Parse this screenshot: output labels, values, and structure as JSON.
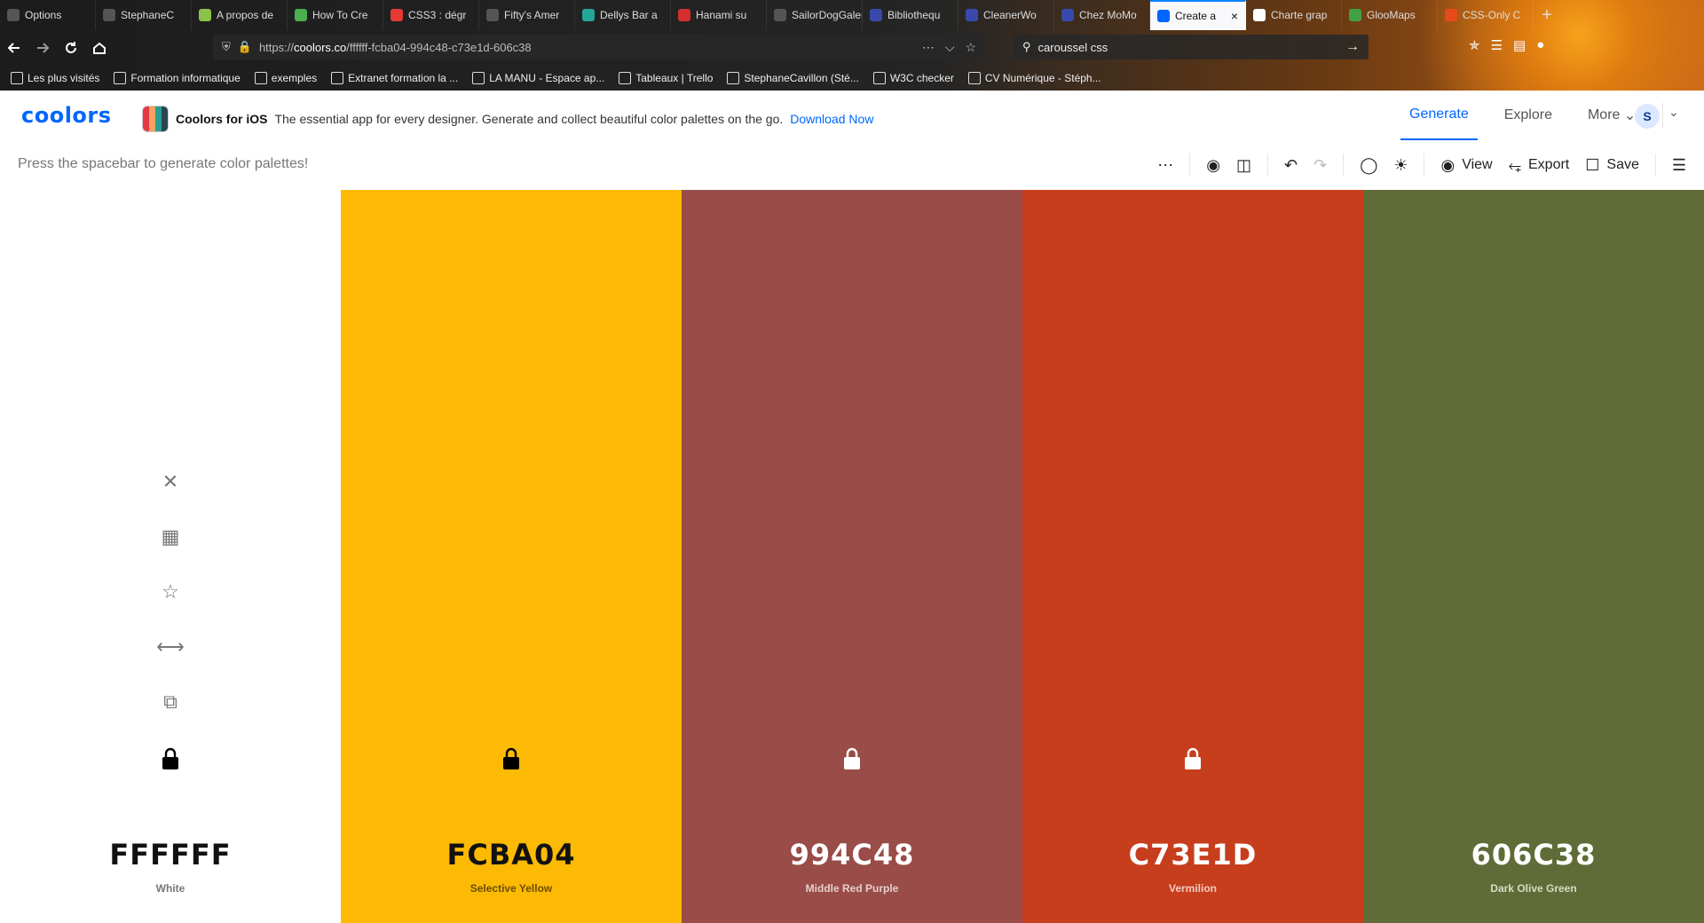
{
  "browser": {
    "tabs": [
      {
        "label": "Options",
        "color": "#555555",
        "active": false
      },
      {
        "label": "StephaneC",
        "color": "#555555",
        "active": false
      },
      {
        "label": "A propos de",
        "color": "#8bc34a",
        "active": false
      },
      {
        "label": "How To Cre",
        "color": "#4caf50",
        "active": false
      },
      {
        "label": "CSS3 : dégr",
        "color": "#e53935",
        "active": false
      },
      {
        "label": "Fifty's Amer",
        "color": "#555555",
        "active": false
      },
      {
        "label": "Dellys Bar a",
        "color": "#26a69a",
        "active": false
      },
      {
        "label": "Hanami su",
        "color": "#d32f2f",
        "active": false
      },
      {
        "label": "SailorDogGalery",
        "color": "#555555",
        "active": false
      },
      {
        "label": "Bibliothequ",
        "color": "#3949ab",
        "active": false
      },
      {
        "label": "CleanerWo",
        "color": "#3949ab",
        "active": false
      },
      {
        "label": "Chez MoMo",
        "color": "#3949ab",
        "active": false
      },
      {
        "label": "Create a",
        "color": "#0066ff",
        "active": true
      },
      {
        "label": "Charte grap",
        "color": "#ffffff",
        "active": false
      },
      {
        "label": "GlooMaps",
        "color": "#43a047",
        "active": false
      },
      {
        "label": "CSS-Only C",
        "color": "#e64a19",
        "active": false
      }
    ],
    "url_prefix": "https://",
    "url_host": "coolors.co",
    "url_path": "/ffffff-fcba04-994c48-c73e1d-606c38",
    "search_value": "caroussel css",
    "bookmarks": [
      {
        "label": "Les plus visités",
        "icon": "gear-icon"
      },
      {
        "label": "Formation informatique",
        "icon": "folder-icon"
      },
      {
        "label": "exemples",
        "icon": "folder-icon"
      },
      {
        "label": "Extranet formation la ...",
        "icon": "d-logo-icon"
      },
      {
        "label": "LA MANU - Espace ap...",
        "icon": "manu-logo-icon"
      },
      {
        "label": "Tableaux | Trello",
        "icon": "trello-icon"
      },
      {
        "label": "StephaneCavillon (Sté...",
        "icon": "github-icon"
      },
      {
        "label": "W3C checker",
        "icon": "w3c-icon"
      },
      {
        "label": "CV Numérique - Stéph...",
        "icon": "globe-icon"
      }
    ]
  },
  "app": {
    "logo": "coolors",
    "promo_title": "Coolors for iOS",
    "promo_text": "The essential app for every designer. Generate and collect beautiful color palettes on the go.",
    "promo_link": "Download Now",
    "nav": {
      "generate": "Generate",
      "explore": "Explore",
      "more": "More"
    },
    "avatar_initial": "S",
    "hint": "Press the spacebar to generate color palettes!",
    "toolbar": {
      "view": "View",
      "export": "Export",
      "save": "Save"
    },
    "accent": "#0066ff"
  },
  "palette": [
    {
      "hex": "FFFFFF",
      "name": "White",
      "bg": "#ffffff",
      "fg": "#111111",
      "name_color": "#777777",
      "locked": true
    },
    {
      "hex": "FCBA04",
      "name": "Selective Yellow",
      "bg": "#fcba04",
      "fg": "#111111",
      "name_color": "#6b4f00",
      "locked": true
    },
    {
      "hex": "994C48",
      "name": "Middle Red Purple",
      "bg": "#994c48",
      "fg": "#ffffff",
      "name_color": "#e7cfcd",
      "locked": true
    },
    {
      "hex": "C73E1D",
      "name": "Vermilion",
      "bg": "#c73e1d",
      "fg": "#ffffff",
      "name_color": "#f2cbc1",
      "locked": true
    },
    {
      "hex": "606C38",
      "name": "Dark Olive Green",
      "bg": "#606c38",
      "fg": "#ffffff",
      "name_color": "#d6dcc4",
      "locked": false
    }
  ],
  "swatch_tools": [
    "close-icon",
    "grid-icon",
    "star-icon",
    "drag-arrows-icon",
    "copy-icon"
  ]
}
